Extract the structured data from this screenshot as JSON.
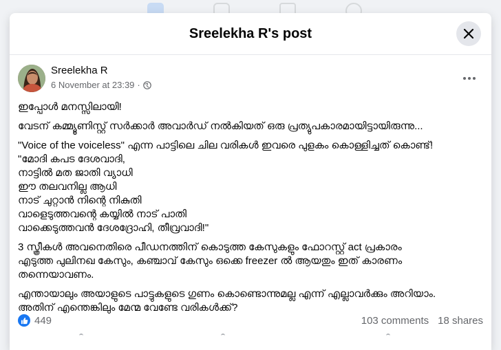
{
  "modal": {
    "title": "Sreelekha R's post"
  },
  "post": {
    "author": "Sreelekha R",
    "timestamp": "6 November at 23:39",
    "separator": "·",
    "audience_icon": "globe-icon",
    "lines": [
      "ഇപ്പോൾ മനസ്സിലായി!",
      "വേടന് കമ്മ്യൂണിസ്റ്റ് സർക്കാർ അവാർഡ് നൽകിയത് ഒരു പ്രത്യുപകാരമായിട്ടായിരുന്നു...",
      "\"Voice of the voiceless\" എന്ന പാട്ടിലെ ചില വരികൾ ഇവരെ പുളകം കൊള്ളിച്ചത് കൊണ്ട്!",
      "\"മോദി കപട ദേശവാദി,",
      "നാട്ടിൽ മത ജാതി വ്യാധി",
      "ഈ തലവനില്ല ആധി",
      "നാട് ചുറ്റാൻ നിന്റെ നികുതി",
      "വാളെടുത്തവന്റെ കയ്യിൽ നാട് പാതി",
      "വാക്കെടുത്തവൻ ദേശദ്രോഹി, തീവ്രവാദി!\"",
      "3 സ്ത്രീകൾ അവനെതിരെ പീഡനത്തിന് കൊടുത്ത കേസുകളും ഫോറസ്റ്റ് act പ്രകാരം",
      "എടുത്ത പുലിനഖ കേസും, കഞ്ചാവ് കേസും ഒക്കെ freezer ൽ ആയതും ഇത് കാരണം",
      "തന്നെയാവണം.",
      "എന്തായാലും അയാളുടെ പാട്ടുകളുടെ ഗുണം കൊണ്ടൊന്നുമല്ല എന്ന് എല്ലാവർക്കും അറിയാം.",
      "അതിന് എന്തെങ്കിലും മേന്മ വേണ്ടേ വരികൾക്ക്?"
    ]
  },
  "stats": {
    "likes": "449",
    "comments": "103 comments",
    "shares": "18 shares"
  },
  "colors": {
    "brand": "#1877f2",
    "secondary_text": "#65676b",
    "background": "#f0f2f5"
  }
}
